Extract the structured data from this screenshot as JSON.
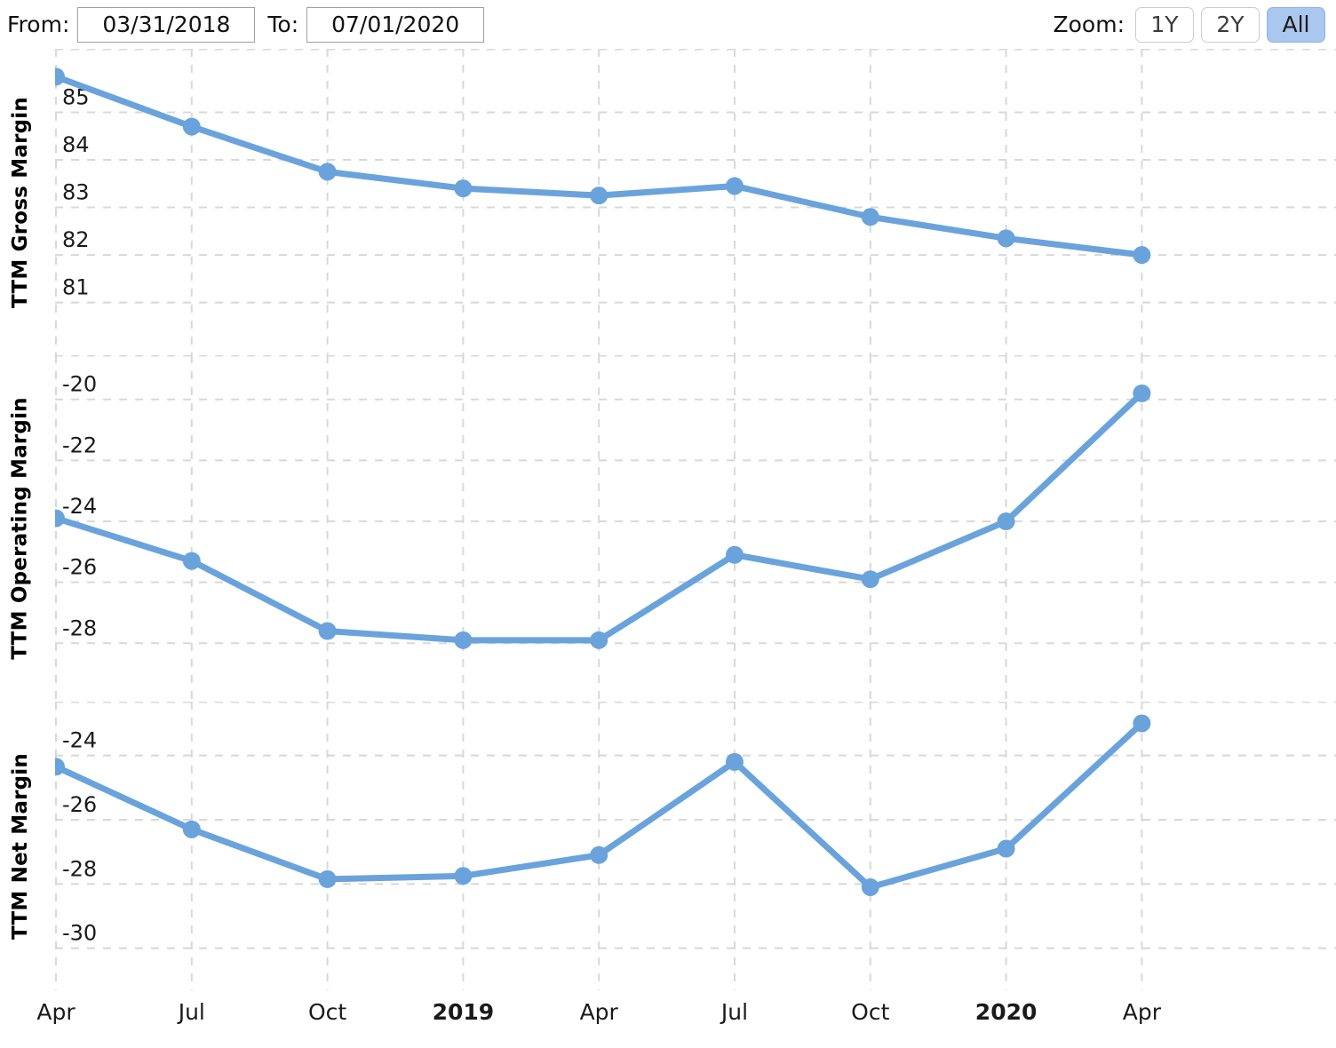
{
  "toolbar": {
    "from_label": "From:",
    "from_value": "03/31/2018",
    "to_label": "To:",
    "to_value": "07/01/2020",
    "zoom_label": "Zoom:",
    "zoom_options": [
      {
        "label": "1Y",
        "active": false
      },
      {
        "label": "2Y",
        "active": false
      },
      {
        "label": "All",
        "active": true
      }
    ]
  },
  "style": {
    "series_color": "#6aa3dc",
    "grid_color": "#d8d8d8",
    "active_button_bg": "#aac7ef",
    "text_color": "#1a1a1a"
  },
  "xaxis": {
    "ticks": [
      {
        "label": "Apr",
        "bold": false
      },
      {
        "label": "Jul",
        "bold": false
      },
      {
        "label": "Oct",
        "bold": false
      },
      {
        "label": "2019",
        "bold": true
      },
      {
        "label": "Apr",
        "bold": false
      },
      {
        "label": "Jul",
        "bold": false
      },
      {
        "label": "Oct",
        "bold": false
      },
      {
        "label": "2020",
        "bold": true
      },
      {
        "label": "Apr",
        "bold": false
      }
    ]
  },
  "chart_data": [
    {
      "type": "line",
      "title": "",
      "ylabel": "TTM Gross Margin",
      "xlabel": "",
      "grid": true,
      "legend": "none",
      "x": [
        "2018-04",
        "2018-07",
        "2018-10",
        "2019-01",
        "2019-04",
        "2019-07",
        "2019-10",
        "2020-01",
        "2020-04"
      ],
      "xticklabels": [
        "Apr",
        "Jul",
        "Oct",
        "2019",
        "Apr",
        "Jul",
        "Oct",
        "2020",
        "Apr"
      ],
      "yticks": [
        85,
        84,
        83,
        82,
        81
      ],
      "ylim": [
        80.6,
        86.0
      ],
      "values": [
        85.75,
        84.7,
        83.75,
        83.4,
        83.25,
        83.45,
        82.8,
        82.35,
        82.0
      ]
    },
    {
      "type": "line",
      "title": "",
      "ylabel": "TTM Operating Margin",
      "xlabel": "",
      "grid": true,
      "legend": "none",
      "x": [
        "2018-04",
        "2018-07",
        "2018-10",
        "2019-01",
        "2019-04",
        "2019-07",
        "2019-10",
        "2020-01",
        "2020-04"
      ],
      "xticklabels": [
        "Apr",
        "Jul",
        "Oct",
        "2019",
        "Apr",
        "Jul",
        "Oct",
        "2020",
        "Apr"
      ],
      "yticks": [
        -20,
        -22,
        -24,
        -26,
        -28
      ],
      "ylim": [
        -29.1,
        -18.9
      ],
      "values": [
        -23.9,
        -25.3,
        -27.6,
        -27.9,
        -27.9,
        -25.1,
        -25.9,
        -24.0,
        -19.8
      ]
    },
    {
      "type": "line",
      "title": "",
      "ylabel": "TTM Net Margin",
      "xlabel": "",
      "grid": true,
      "legend": "none",
      "x": [
        "2018-04",
        "2018-07",
        "2018-10",
        "2019-01",
        "2019-04",
        "2019-07",
        "2019-10",
        "2020-01",
        "2020-04"
      ],
      "xticklabels": [
        "Apr",
        "Jul",
        "Oct",
        "2019",
        "Apr",
        "Jul",
        "Oct",
        "2020",
        "Apr"
      ],
      "yticks": [
        -24,
        -26,
        -28,
        -30
      ],
      "ylim": [
        -30.7,
        -22.6
      ],
      "values": [
        -24.35,
        -26.3,
        -27.85,
        -27.75,
        -27.1,
        -24.2,
        -28.1,
        -26.9,
        -23.0
      ]
    }
  ]
}
